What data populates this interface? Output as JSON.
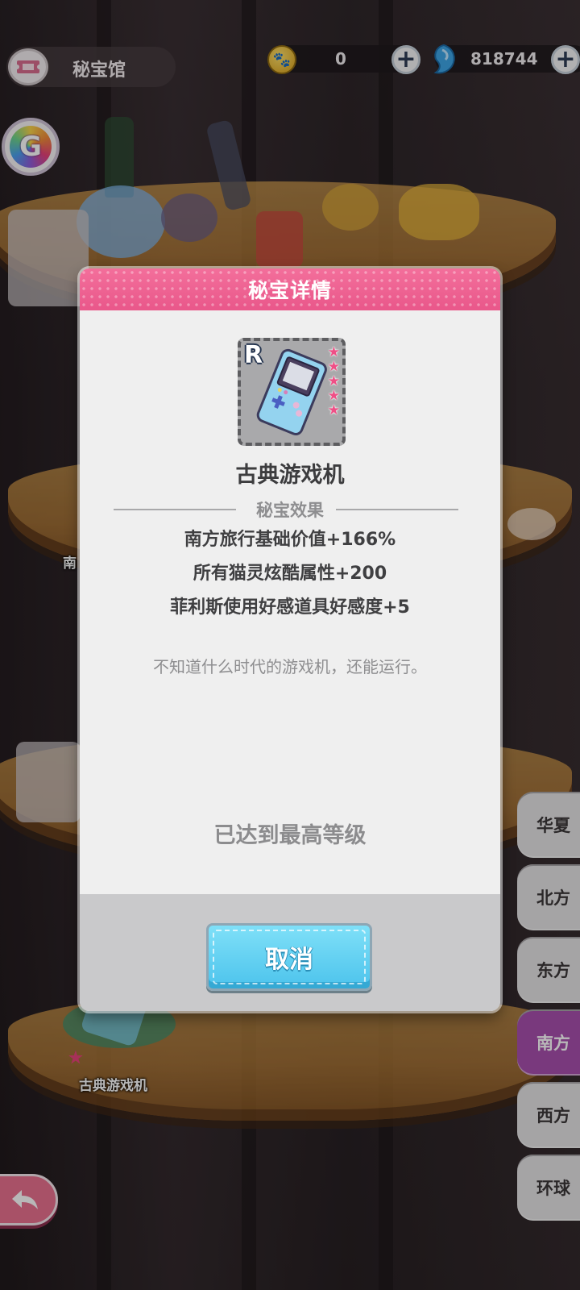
{
  "header": {
    "page_title": "秘宝馆",
    "currencies": [
      {
        "icon": "paw-coin-icon",
        "value": "0"
      },
      {
        "icon": "blue-gem-icon",
        "value": "818744"
      }
    ]
  },
  "background": {
    "partial_label": "南",
    "item_label": "古典游戏机",
    "item_stars": 5
  },
  "modal": {
    "title": "秘宝详情",
    "item": {
      "name": "古典游戏机",
      "rarity": "R",
      "stars": 5,
      "icon": "handheld-game-console-icon"
    },
    "effects_title": "秘宝效果",
    "effects": [
      "南方旅行基础价值+166%",
      "所有猫灵炫酷属性+200",
      "菲利斯使用好感道具好感度+5"
    ],
    "description": "不知道什么时代的游戏机，还能运行。",
    "status": "已达到最高等级",
    "cancel_label": "取消"
  },
  "region_tabs": [
    {
      "label": "华夏",
      "active": false
    },
    {
      "label": "北方",
      "active": false
    },
    {
      "label": "东方",
      "active": false
    },
    {
      "label": "南方",
      "active": true
    },
    {
      "label": "西方",
      "active": false
    },
    {
      "label": "环球",
      "active": false
    }
  ],
  "colors": {
    "accent_pink": "#e9578a",
    "tab_active": "#a84fae",
    "cancel_blue": "#4cc3ec"
  }
}
